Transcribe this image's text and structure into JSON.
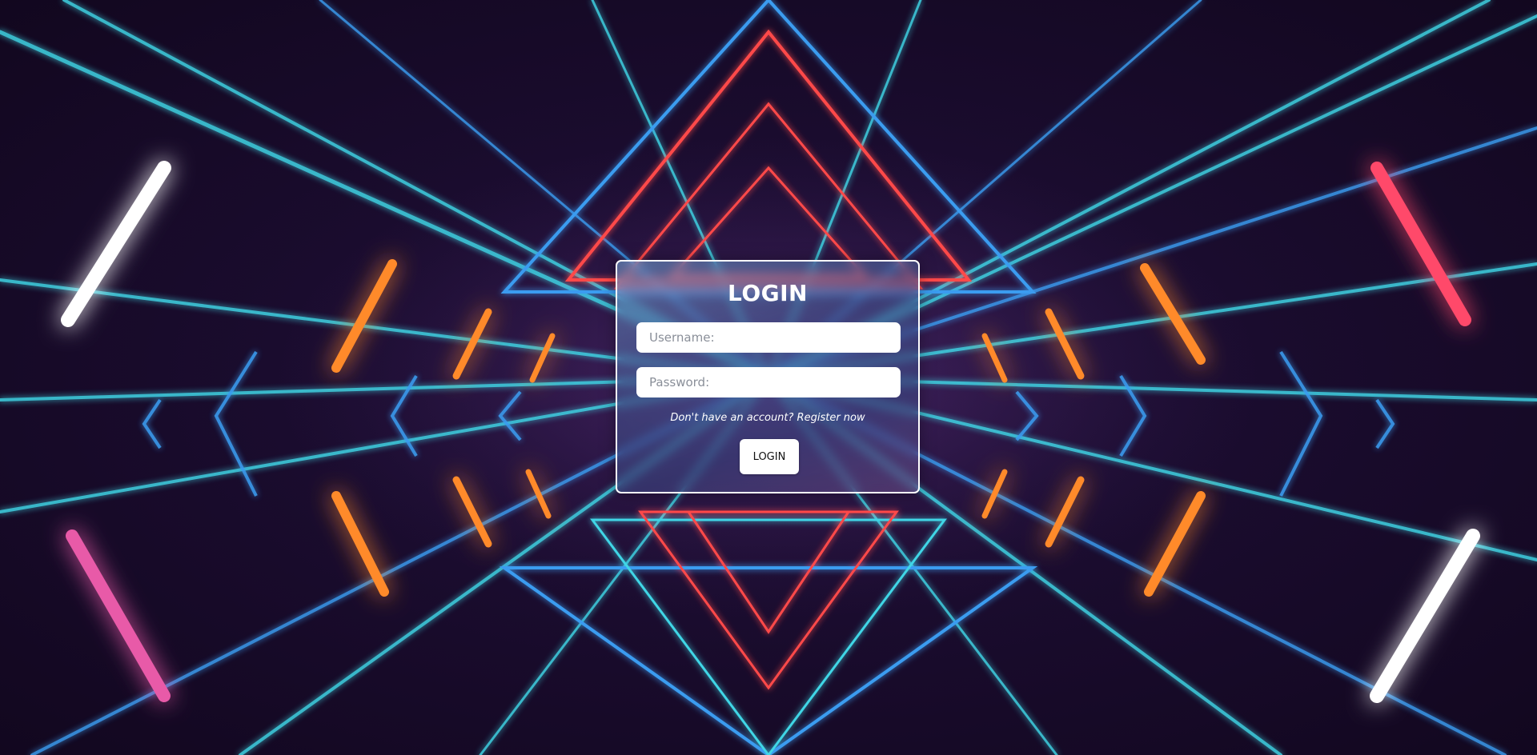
{
  "login": {
    "title": "LOGIN",
    "username_placeholder": "Username:",
    "password_placeholder": "Password:",
    "register_text": "Don't have an account? Register now",
    "button_label": "LOGIN"
  },
  "background": {
    "art": "neon-laser-tunnel",
    "colors": {
      "base": "#170a26",
      "cyan": "#3fd6e6",
      "blue": "#3a9cf0",
      "red": "#ff4a4a",
      "orange": "#ff8a2a",
      "pink": "#e85aa8",
      "white": "#ffffff"
    }
  }
}
